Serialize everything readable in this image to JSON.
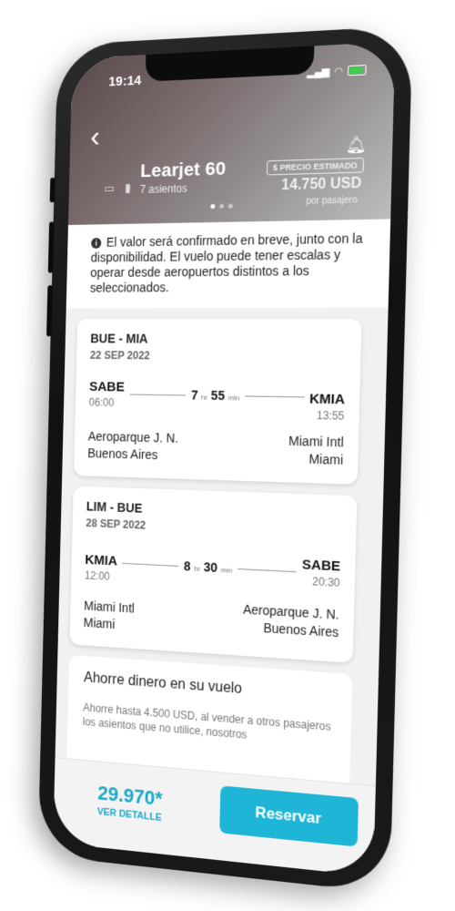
{
  "status": {
    "time": "19:14"
  },
  "header": {
    "aircraft": "Learjet 60",
    "seats": "7 asientos",
    "price_badge": "$ PRECIO ESTIMADO",
    "price": "14.750 USD",
    "price_sub": "por pasajero"
  },
  "notice": {
    "text": "El valor será confirmado en breve, junto con la disponibilidad. El vuelo puede tener escalas y operar desde aeropuertos distintos a los seleccionados."
  },
  "flights": [
    {
      "route": "BUE - MIA",
      "date": "22 SEP 2022",
      "from_code": "SABE",
      "from_time": "06:00",
      "dur_h": "7",
      "dur_h_unit": "hr",
      "dur_m": "55",
      "dur_m_unit": "min",
      "to_code": "KMIA",
      "to_time": "13:55",
      "from_airport": "Aeroparque J. N.",
      "from_city": "Buenos Aires",
      "to_airport": "Miami Intl",
      "to_city": "Miami"
    },
    {
      "route": "LIM - BUE",
      "date": "28 SEP 2022",
      "from_code": "KMIA",
      "from_time": "12:00",
      "dur_h": "8",
      "dur_h_unit": "hr",
      "dur_m": "30",
      "dur_m_unit": "min",
      "to_code": "SABE",
      "to_time": "20:30",
      "from_airport": "Miami Intl",
      "from_city": "Miami",
      "to_airport": "Aeroparque J. N.",
      "to_city": "Buenos Aires"
    }
  ],
  "savings": {
    "title": "Ahorre dinero en su vuelo",
    "text": "Ahorre hasta 4.500 USD, al vender a otros pasajeros los asientos que no utilice, nosotros"
  },
  "footer": {
    "total": "29.970*",
    "detail": "VER DETALLE",
    "reserve": "Reservar"
  },
  "colors": {
    "accent": "#1fb5d6",
    "accent_text": "#1ba9c7"
  }
}
